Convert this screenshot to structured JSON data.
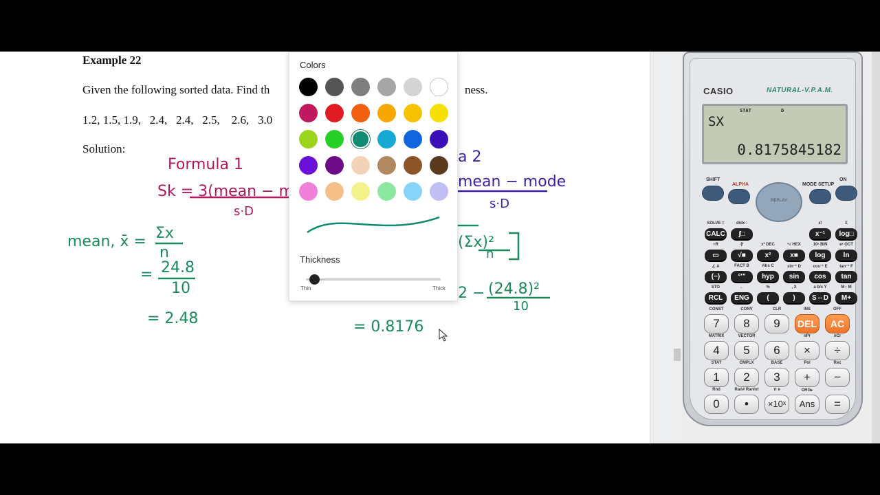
{
  "document": {
    "example_title": "Example 22",
    "line1": "Given the following sorted data. Find th",
    "line1_suffix": "ness.",
    "data_values": "1.2, 1.5, 1.9,   2.4,   2.4,   2.5,    2.6,   3.0",
    "solution_label": "Solution:"
  },
  "handwriting": {
    "formula_label": "Formula 1",
    "sk_formula": "Sk = 3(mean − med",
    "sd_denominator": "s·D",
    "formula2_label": "a 2",
    "formula2_numerator": "mean − mode",
    "formula2_denominator": "s·D",
    "mean_label": "mean, x̄ =",
    "mean_num": "Σx",
    "mean_den": "n",
    "step2_num": "24.8",
    "step2_den": "10",
    "mean_result": "= 2.48",
    "var_part": "(Σx)²",
    "var_den": "n",
    "step_sub": "(24.8)²",
    "step_sub_den": "10",
    "sd_result": "= 0.8176",
    "colors": {
      "red_ink": "#b0195f",
      "green_ink": "#1a8a5a",
      "purple_ink": "#3c1fa6"
    }
  },
  "color_picker": {
    "header": "Colors",
    "thickness_label": "Thickness",
    "thin_label": "Thin",
    "thick_label": "Thick",
    "selected_color": "#118a72",
    "thickness_value": 0.02,
    "swatches": [
      "#000000",
      "#555555",
      "#7f7f7f",
      "#a6a6a6",
      "#d4d4d4",
      "#ffffff",
      "#c0185e",
      "#e01b24",
      "#f06010",
      "#f7a800",
      "#f7c300",
      "#f7e000",
      "#9ad41c",
      "#27d027",
      "#118a72",
      "#16a9d3",
      "#1166e0",
      "#3b10b8",
      "#6a10d8",
      "#6c0c86",
      "#f3d3b7",
      "#b08960",
      "#8b5528",
      "#5c3a1e",
      "#f080d8",
      "#f4c088",
      "#f4f28a",
      "#8ce89e",
      "#88d4f8",
      "#c0c0f4"
    ]
  },
  "calculator": {
    "brand": "CASIO",
    "model": "NATURAL-V.P.A.M.",
    "indicator_stat": "STAT",
    "indicator_d": "D",
    "display_expression": "SX",
    "display_result": "0.8175845182",
    "shift_label": "SHIFT",
    "alpha_label": "ALPHA",
    "replay_label": "REPLAY",
    "mode_label": "MODE SETUP",
    "on_label": "ON",
    "func_rows": [
      {
        "top": [
          "SOLVE =",
          "d/dx :",
          "",
          "",
          "x!",
          "Σ"
        ],
        "keys": [
          "CALC",
          "∫□",
          "",
          "",
          "x⁻¹",
          "log□"
        ]
      },
      {
        "top": [
          "÷R",
          "∛",
          "x³ DEC",
          "ˣ√ HEX",
          "10ˣ BIN",
          "eˣ OCT"
        ],
        "keys": [
          "▭",
          "√■",
          "x²",
          "x■",
          "log",
          "ln"
        ]
      },
      {
        "top": [
          "∠ A",
          "FACT B",
          "Abs C",
          "sin⁻¹ D",
          "cos⁻¹ E",
          "tan⁻¹ F"
        ],
        "keys": [
          "(−)",
          "°'\"",
          "hyp",
          "sin",
          "cos",
          "tan"
        ]
      },
      {
        "top": [
          "STO",
          "←",
          "%",
          ", X",
          "a b/c Y",
          "M− M"
        ],
        "keys": [
          "RCL",
          "ENG",
          "(",
          ")",
          "S⇔D",
          "M+"
        ]
      }
    ],
    "num_rows": [
      {
        "top": [
          "CONST",
          "CONV",
          "CLR",
          "INS",
          "OFF"
        ],
        "keys": [
          "7",
          "8",
          "9",
          "DEL",
          "AC"
        ]
      },
      {
        "top": [
          "MATRIX",
          "VECTOR",
          "",
          "nPr",
          "nCr"
        ],
        "keys": [
          "4",
          "5",
          "6",
          "×",
          "÷"
        ]
      },
      {
        "top": [
          "STAT",
          "CMPLX",
          "BASE",
          "Pol",
          "Rec"
        ],
        "keys": [
          "1",
          "2",
          "3",
          "+",
          "−"
        ]
      },
      {
        "top": [
          "Rnd",
          "Ran# RanInt",
          "π e",
          "DRG▸",
          ""
        ],
        "keys": [
          "0",
          "•",
          "×10ˣ",
          "Ans",
          "="
        ]
      }
    ]
  }
}
